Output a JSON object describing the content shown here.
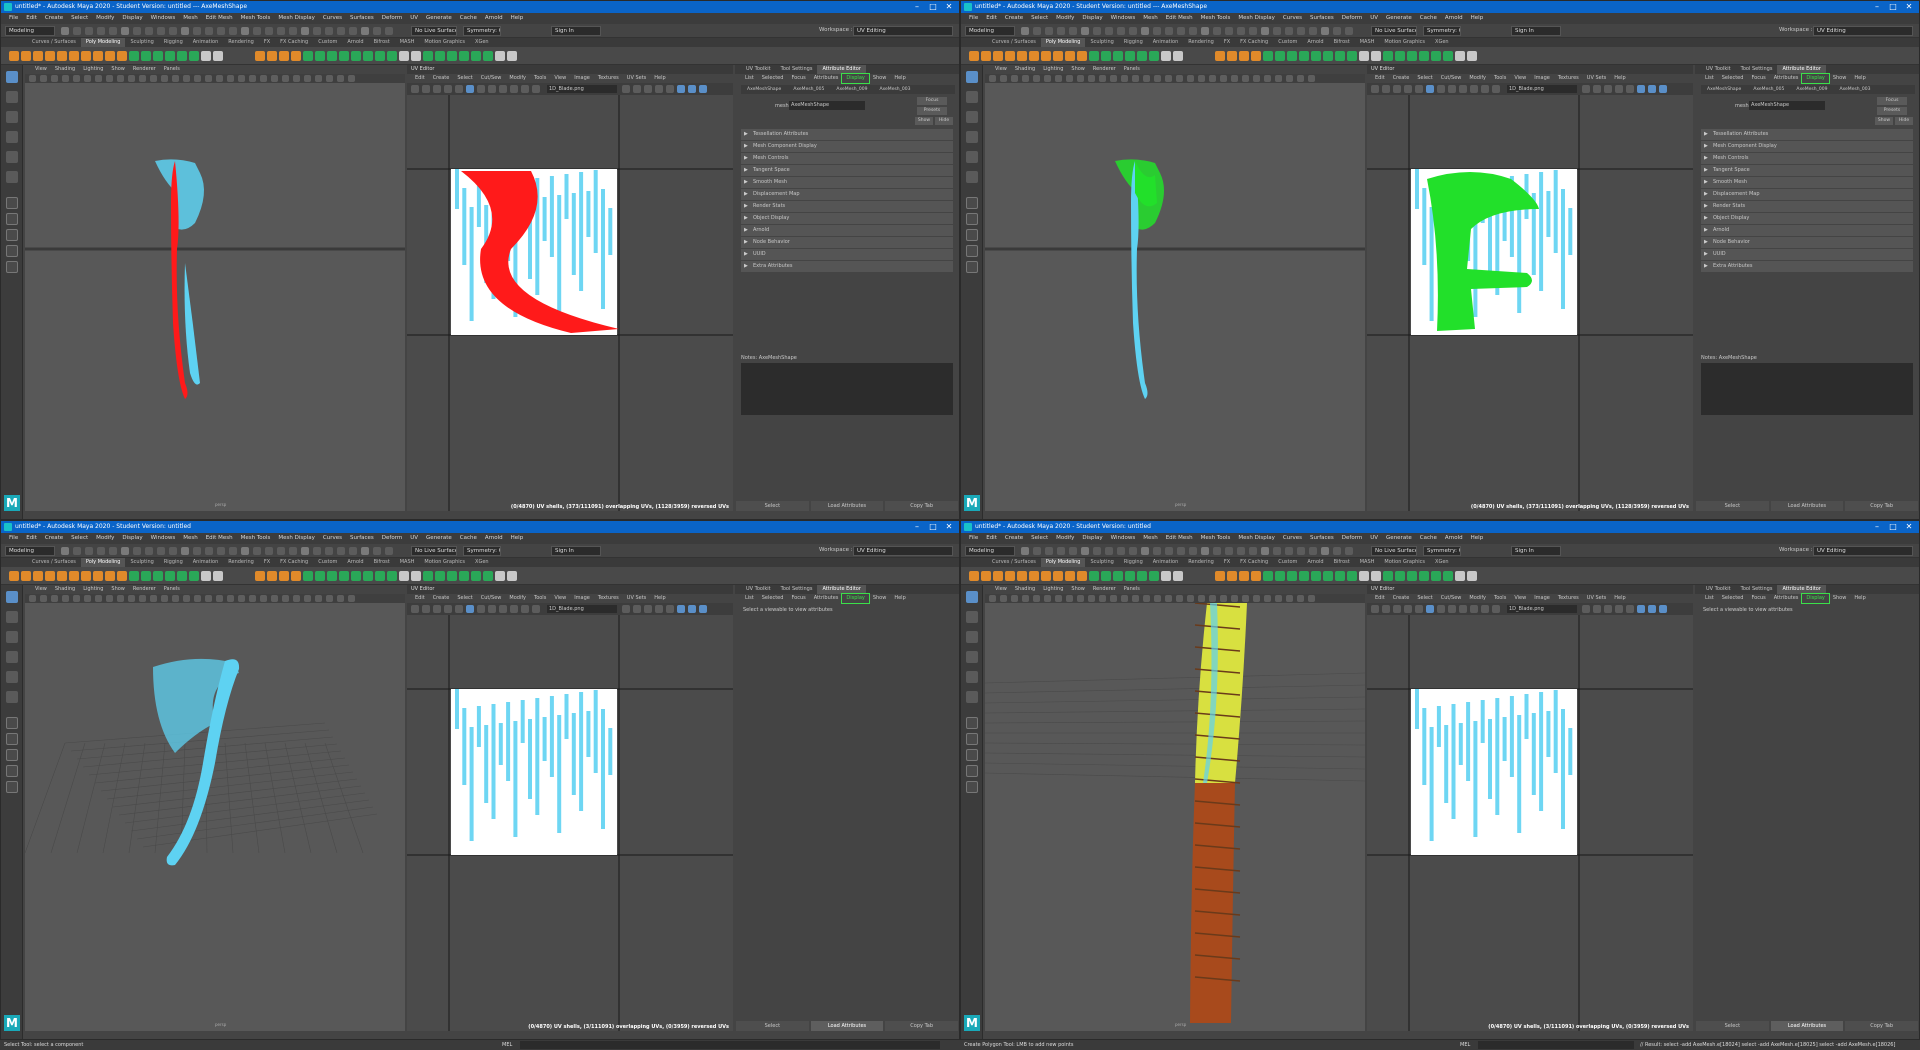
{
  "app": {
    "titles": [
      "untitled* - Autodesk Maya 2020 - Student Version: untitled  ---  AxeMeshShape",
      "untitled* - Autodesk Maya 2020 - Student Version: untitled  ---  AxeMeshShape",
      "untitled* - Autodesk Maya 2020 - Student Version: untitled",
      "untitled* - Autodesk Maya 2020 - Student Version: untitled"
    ],
    "menus": [
      "File",
      "Edit",
      "Create",
      "Select",
      "Modify",
      "Display",
      "Windows",
      "Mesh",
      "Edit Mesh",
      "Mesh Tools",
      "Mesh Display",
      "Curves",
      "Surfaces",
      "Deform",
      "UV",
      "Generate",
      "Cache",
      "Arnold",
      "Help"
    ],
    "menuset": "Modeling",
    "workspace_label": "Workspace :",
    "workspace": "UV Editing",
    "live_surface": "No Live Surface",
    "symmetry": "Symmetry: Off",
    "sign_in": "Sign In",
    "shelf_tabs": [
      "Curves / Surfaces",
      "Poly Modeling",
      "Sculpting",
      "Rigging",
      "Animation",
      "Rendering",
      "FX",
      "FX Caching",
      "Custom",
      "Arnold",
      "Bifrost",
      "MASH",
      "Motion Graphics",
      "XGen"
    ],
    "active_shelf": "Poly Modeling",
    "colors": {
      "title_blue": "#0a64c8",
      "uv_cyan": "#5ed2f2",
      "selected_red": "#ff1a1a",
      "selected_green": "#22e02a",
      "handle_yellow": "#d8e040",
      "handle_rust": "#a84a1c"
    }
  },
  "viewport": {
    "menu": [
      "View",
      "Shading",
      "Lighting",
      "Show",
      "Renderer",
      "Panels"
    ],
    "camera": "persp"
  },
  "uv_editor": {
    "title": "UV Editor",
    "menu": [
      "Edit",
      "Create",
      "Select",
      "Cut/Sew",
      "Modify",
      "Tools",
      "View",
      "Image",
      "Textures",
      "UV Sets",
      "Help"
    ],
    "images": [
      "1D_Blade.png",
      "1D_Blade.png",
      "1D_Blade.png",
      "1D_Blade.png"
    ],
    "status": [
      "(0/4870) UV shells, (373/111091) overlapping UVs, (1128/3959) reversed UVs",
      "(0/4870) UV shells, (373/111091) overlapping UVs, (1128/3959) reversed UVs",
      "(0/4870) UV shells, (3/111091) overlapping UVs, (0/3959) reversed UVs",
      "(0/4870) UV shells, (3/111091) overlapping UVs, (0/3959) reversed UVs"
    ]
  },
  "attribute_editor": {
    "tabs": [
      "UV Toolkit",
      "Tool Settings",
      "Attribute Editor"
    ],
    "menu": [
      "List",
      "Selected",
      "Focus",
      "Attributes",
      "Display",
      "Show",
      "Help"
    ],
    "node_tabs": [
      "AxeMeshShape",
      "AxeMesh_005",
      "AxeMesh_009",
      "AxeMesh_003"
    ],
    "mesh_label": "mesh:",
    "mesh_value": "AxeMeshShape",
    "buttons": [
      "Focus",
      "Presets",
      "Show",
      "Hide"
    ],
    "sections": [
      "Tessellation Attributes",
      "Mesh Component Display",
      "Mesh Controls",
      "Tangent Space",
      "Smooth Mesh",
      "Displacement Map",
      "Render Stats",
      "Object Display",
      "Arnold",
      "Node Behavior",
      "UUID",
      "Extra Attributes"
    ],
    "notes": "Notes:  AxeMeshShape",
    "empty_message": "Select a viewable to view attributes",
    "bottom": [
      "Select",
      "Load Attributes",
      "Copy Tab"
    ]
  },
  "help_line": {
    "left": "Select Tool: select a component",
    "left2": "Create Polygon Tool: LMB to add new points",
    "mel": "MEL",
    "mel2": "MEL",
    "right": "// Result: select -add AxeMesh.e[18024] select -add AxeMesh.e[18025] select -add AxeMesh.e[18026]"
  }
}
